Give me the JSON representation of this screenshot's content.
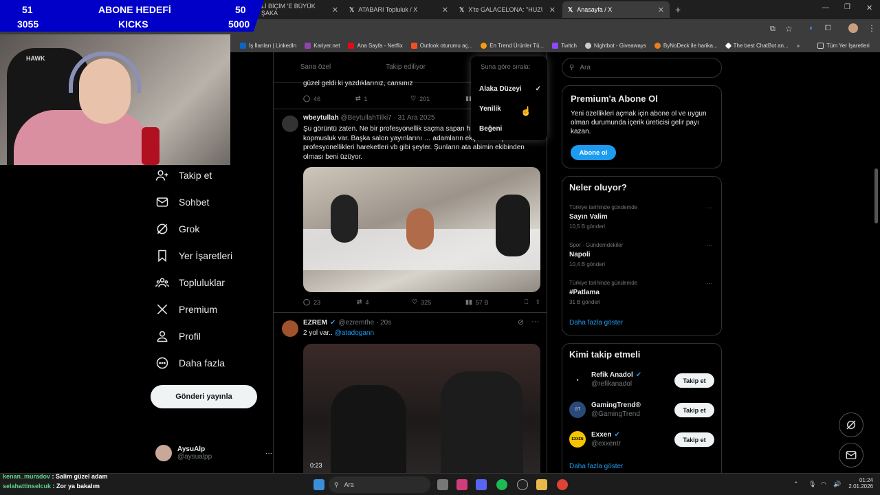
{
  "overlay": {
    "goal_current": "51",
    "goal_title": "ABONE HEDEFİ",
    "goal_target": "50",
    "kicks_current": "3055",
    "kicks_title": "KICKS",
    "kicks_target": "5000",
    "goal_color": "#0000c8"
  },
  "browser": {
    "tabs": [
      {
        "label": "Lİ BİÇİM 'E BÜYÜK ŞAKA",
        "active": false
      },
      {
        "label": "ATABARI Topluluk / X",
        "active": false
      },
      {
        "label": "X'te GALACELONA: \"HUZURR!\"",
        "active": false
      },
      {
        "label": "Anasayfa / X",
        "active": true
      }
    ],
    "new_tab": "+",
    "bookmarks": [
      "İş İlanları | LinkedIn",
      "Kariyer.net",
      "Ana Sayfa - Netflix",
      "Outlook oturumu aç...",
      "En Trend Ürünler Tü...",
      "Twitch",
      "Nightbot - Giveaways",
      "ByNoDeck ile harika...",
      "The best ChatBot an..."
    ],
    "bookmarks_more": "»",
    "all_bookmarks": "Tüm Yer İşaretleri"
  },
  "nav": {
    "items": [
      "Takip et",
      "Sohbet",
      "Grok",
      "Yer İşaretleri",
      "Topluluklar",
      "Premium",
      "Profil",
      "Daha fazla"
    ],
    "post_button": "Gönderi yayınla",
    "account_name": "AysuAlp",
    "account_handle": "@aysualpp",
    "account_more": "···"
  },
  "feed": {
    "tabs": [
      "Sana özel",
      "Takip ediliyor"
    ],
    "prev_tweet_text": "güzel geldi ki yazdıklarınız, cansınız",
    "prev_tweet_stats": {
      "replies": "46",
      "retweets": "1",
      "likes": "201"
    },
    "tweet1": {
      "name": "wbeytullah",
      "handle": "@BeytullahTilki7 · 31 Ara 2025",
      "text": "Şu görüntü zaten. Ne bir profesyonellik saçma sapan h… burda yayından kopmusluk var. Başka salon yayınlarını … adamların ekip arkadaşlarının profesyonellikleri hareketleri vb gibi şeyler. Şunların ata abimin ekibinden olması beni üzüyor.",
      "replies": "23",
      "retweets": "4",
      "likes": "325",
      "views": "57 B"
    },
    "tweet2": {
      "name": "EZREM",
      "handle": "@ezremthe · 20s",
      "text": "2 yol var..",
      "mention": "@atadogann",
      "video_time": "0:23"
    }
  },
  "sort_menu": {
    "title": "Şuna göre sırala:",
    "options": [
      "Alaka Düzeyi",
      "Yenilik",
      "Beğeni"
    ],
    "selected": "Alaka Düzeyi",
    "check": "✓"
  },
  "sidebar": {
    "search_placeholder": "Ara",
    "premium": {
      "title": "Premium'a Abone Ol",
      "text": "Yeni özellikleri açmak için abone ol ve uygun olman durumunda içerik üreticisi gelir payı kazan.",
      "button": "Abone ol"
    },
    "trends": {
      "title": "Neler oluyor?",
      "items": [
        {
          "context": "Türkiye tarihinde gündemde",
          "name": "Sayın Valim",
          "count": "10,5 B gönderi"
        },
        {
          "context": "Spor · Gündemdekiler",
          "name": "Napoli",
          "count": "10,4 B gönderi"
        },
        {
          "context": "Türkiye tarihinde gündemde",
          "name": "#Patlama",
          "count": "31 B gönderi"
        }
      ],
      "more": "Daha fazla göster",
      "item_more": "···"
    },
    "who_to_follow": {
      "title": "Kimi takip etmeli",
      "items": [
        {
          "name": "Refik Anadol",
          "handle": "@refikanadol"
        },
        {
          "name": "GamingTrend®",
          "handle": "@GamingTrend"
        },
        {
          "name": "Exxen",
          "handle": "@exxentr"
        }
      ],
      "follow_label": "Takip et",
      "more": "Daha fazla göster"
    }
  },
  "chat": [
    {
      "user": "kenan_muradov",
      "msg": "Salim güzel adam"
    },
    {
      "user": "selahattinselcuk",
      "msg": "Zor ya bakalım"
    }
  ],
  "taskbar": {
    "search": "Ara",
    "time": "01:24",
    "date": "2.01.2026"
  },
  "colors": {
    "accent": "#1d9bf0",
    "bg": "#000000",
    "border": "#2f3336"
  }
}
